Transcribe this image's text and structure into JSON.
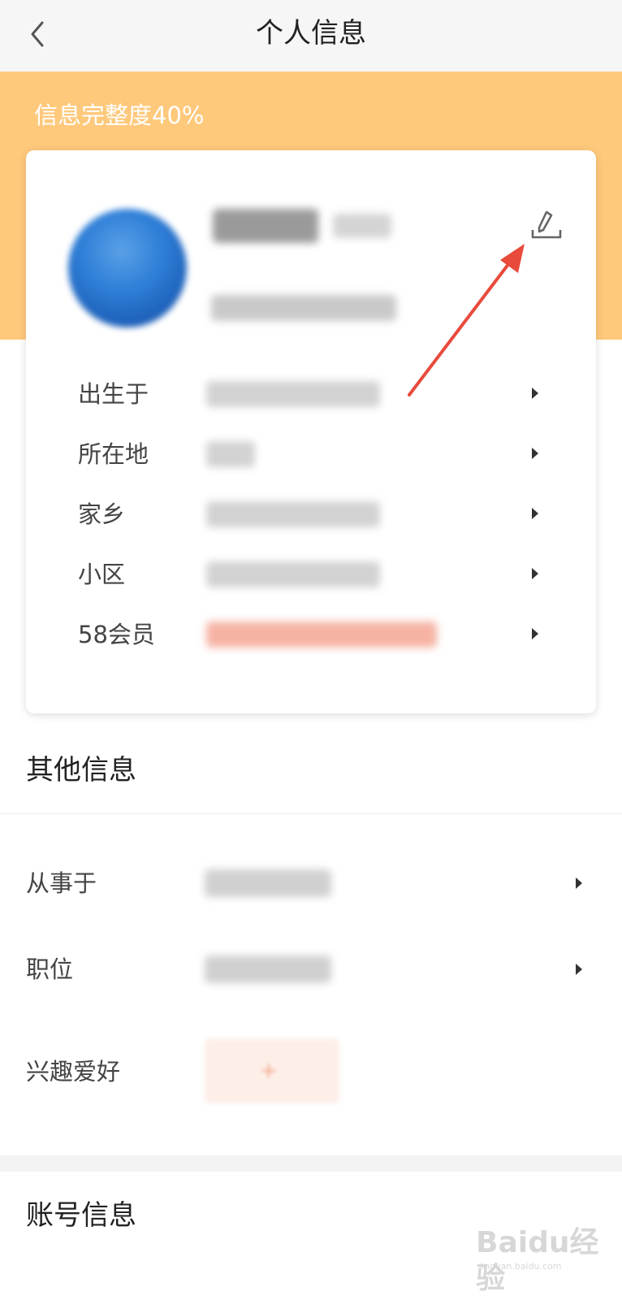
{
  "nav": {
    "title": "个人信息",
    "back_icon": "chevron-left-icon"
  },
  "banner": {
    "completeness": "信息完整度40%",
    "color": "#ffc97c"
  },
  "profile_card": {
    "edit_icon": "pencil-edit-icon",
    "rows": [
      {
        "label": "出生于"
      },
      {
        "label": "所在地"
      },
      {
        "label": "家乡"
      },
      {
        "label": "小区"
      },
      {
        "label": "58会员"
      }
    ]
  },
  "other_info": {
    "title": "其他信息",
    "rows": [
      {
        "label": "从事于"
      },
      {
        "label": "职位"
      },
      {
        "label": "兴趣爱好"
      }
    ],
    "hobby_add": "+"
  },
  "account_info": {
    "title": "账号信息"
  },
  "watermark": {
    "brand": "Baidu经验",
    "url": "jingyan.baidu.com"
  },
  "colors": {
    "accent_red": "#e84a3c",
    "arrow_gray": "#555555"
  }
}
